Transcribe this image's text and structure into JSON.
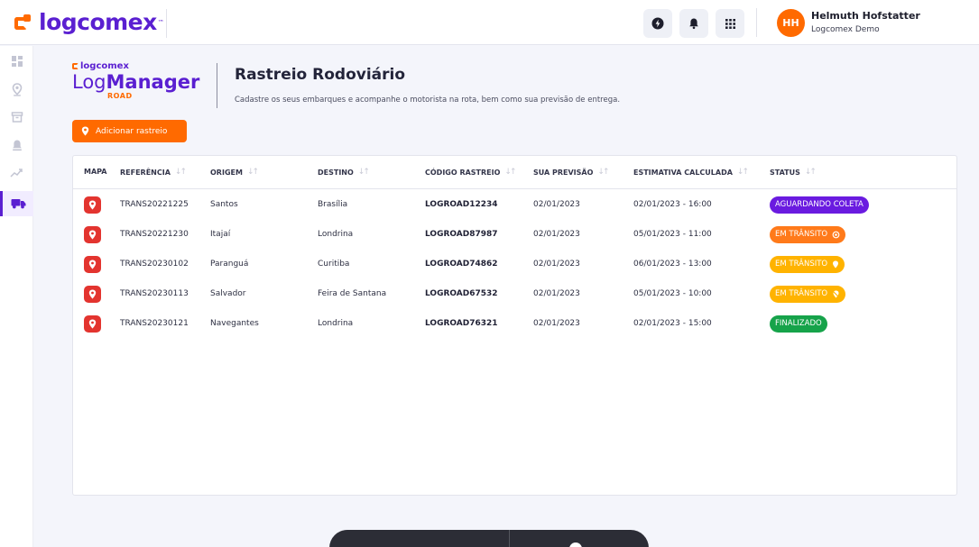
{
  "header": {
    "brand": "logcomex",
    "user": {
      "initials": "HH",
      "name": "Helmuth Hofstatter",
      "org": "Logcomex Demo"
    },
    "icons": [
      "bolt-icon",
      "bell-icon",
      "apps-grid-icon"
    ]
  },
  "sidebar": {
    "items": [
      "dashboard-icon",
      "location-pin-icon",
      "archive-icon",
      "alert-bell-icon",
      "trend-chart-icon",
      "truck-icon"
    ],
    "active": "truck-icon"
  },
  "page": {
    "logo_small": "logcomex",
    "logo_main_light": "Log",
    "logo_main_bold": "Manager",
    "logo_road": "ROAD",
    "title": "Rastreio Rodoviário",
    "subtitle": "Cadastre os seus embarques e acompanhe o motorista na rota, bem como sua previsão de entrega.",
    "add_button": "Adicionar rastreio"
  },
  "table": {
    "columns": {
      "mapa": "MAPA",
      "referencia": "REFERÊNCIA",
      "origem": "ORIGEM",
      "destino": "DESTINO",
      "codigo": "CÓDIGO RASTREIO",
      "previsao": "SUA PREVISÃO",
      "estimativa": "ESTIMATIVA CALCULADA",
      "status": "STATUS"
    },
    "rows": [
      {
        "referencia": "TRANS20221225",
        "origem": "Santos",
        "destino": "Brasília",
        "codigo": "LOGROAD12234",
        "previsao": "02/01/2023",
        "estimativa": "02/01/2023 - 16:00",
        "status": "AGUARDANDO COLETA",
        "status_color": "#6a1be0",
        "status_icon": ""
      },
      {
        "referencia": "TRANS20221230",
        "origem": "Itajaí",
        "destino": "Londrina",
        "codigo": "LOGROAD87987",
        "previsao": "02/01/2023",
        "estimativa": "05/01/2023 - 11:00",
        "status": "EM TRÂNSITO",
        "status_color": "#ff7a1a",
        "status_icon": "target-icon"
      },
      {
        "referencia": "TRANS20230102",
        "origem": "Paranguá",
        "destino": "Curitiba",
        "codigo": "LOGROAD74862",
        "previsao": "02/01/2023",
        "estimativa": "06/01/2023 - 13:00",
        "status": "EM TRÂNSITO",
        "status_color": "#ffb300",
        "status_icon": "pin-icon"
      },
      {
        "referencia": "TRANS20230113",
        "origem": "Salvador",
        "destino": "Feira de Santana",
        "codigo": "LOGROAD67532",
        "previsao": "02/01/2023",
        "estimativa": "05/01/2023 - 10:00",
        "status": "EM TRÂNSITO",
        "status_color": "#ffb300",
        "status_icon": "pin-off-icon"
      },
      {
        "referencia": "TRANS20230121",
        "origem": "Navegantes",
        "destino": "Londrina",
        "codigo": "LOGROAD76321",
        "previsao": "02/01/2023",
        "estimativa": "02/01/2023 - 15:00",
        "status": "FINALIZADO",
        "status_color": "#16a34a",
        "status_icon": ""
      }
    ]
  }
}
